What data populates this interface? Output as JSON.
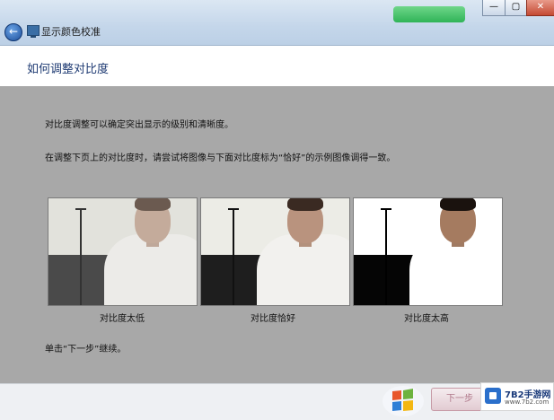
{
  "window": {
    "title": "显示颜色校准",
    "back_icon": "back-arrow-icon",
    "minimize_glyph": "—",
    "maximize_glyph": "▢",
    "close_glyph": "✕"
  },
  "page": {
    "heading": "如何调整对比度",
    "text_intro": "对比度调整可以确定突出显示的级别和清晰度。",
    "text_instruction": "在调整下页上的对比度时，请尝试将图像与下面对比度标为“恰好”的示例图像调得一致。",
    "text_continue": "单击“下一步”继续。"
  },
  "samples": [
    {
      "label": "对比度太低"
    },
    {
      "label": "对比度恰好"
    },
    {
      "label": "对比度太高"
    }
  ],
  "footer": {
    "next_button": "下一步"
  },
  "watermark": {
    "name": "7B2手游网",
    "url": "www.7b2.com"
  },
  "colors": {
    "content_bg": "#a8a8a8",
    "heading": "#1f3b73",
    "titlebar": "#c4d6ea"
  }
}
